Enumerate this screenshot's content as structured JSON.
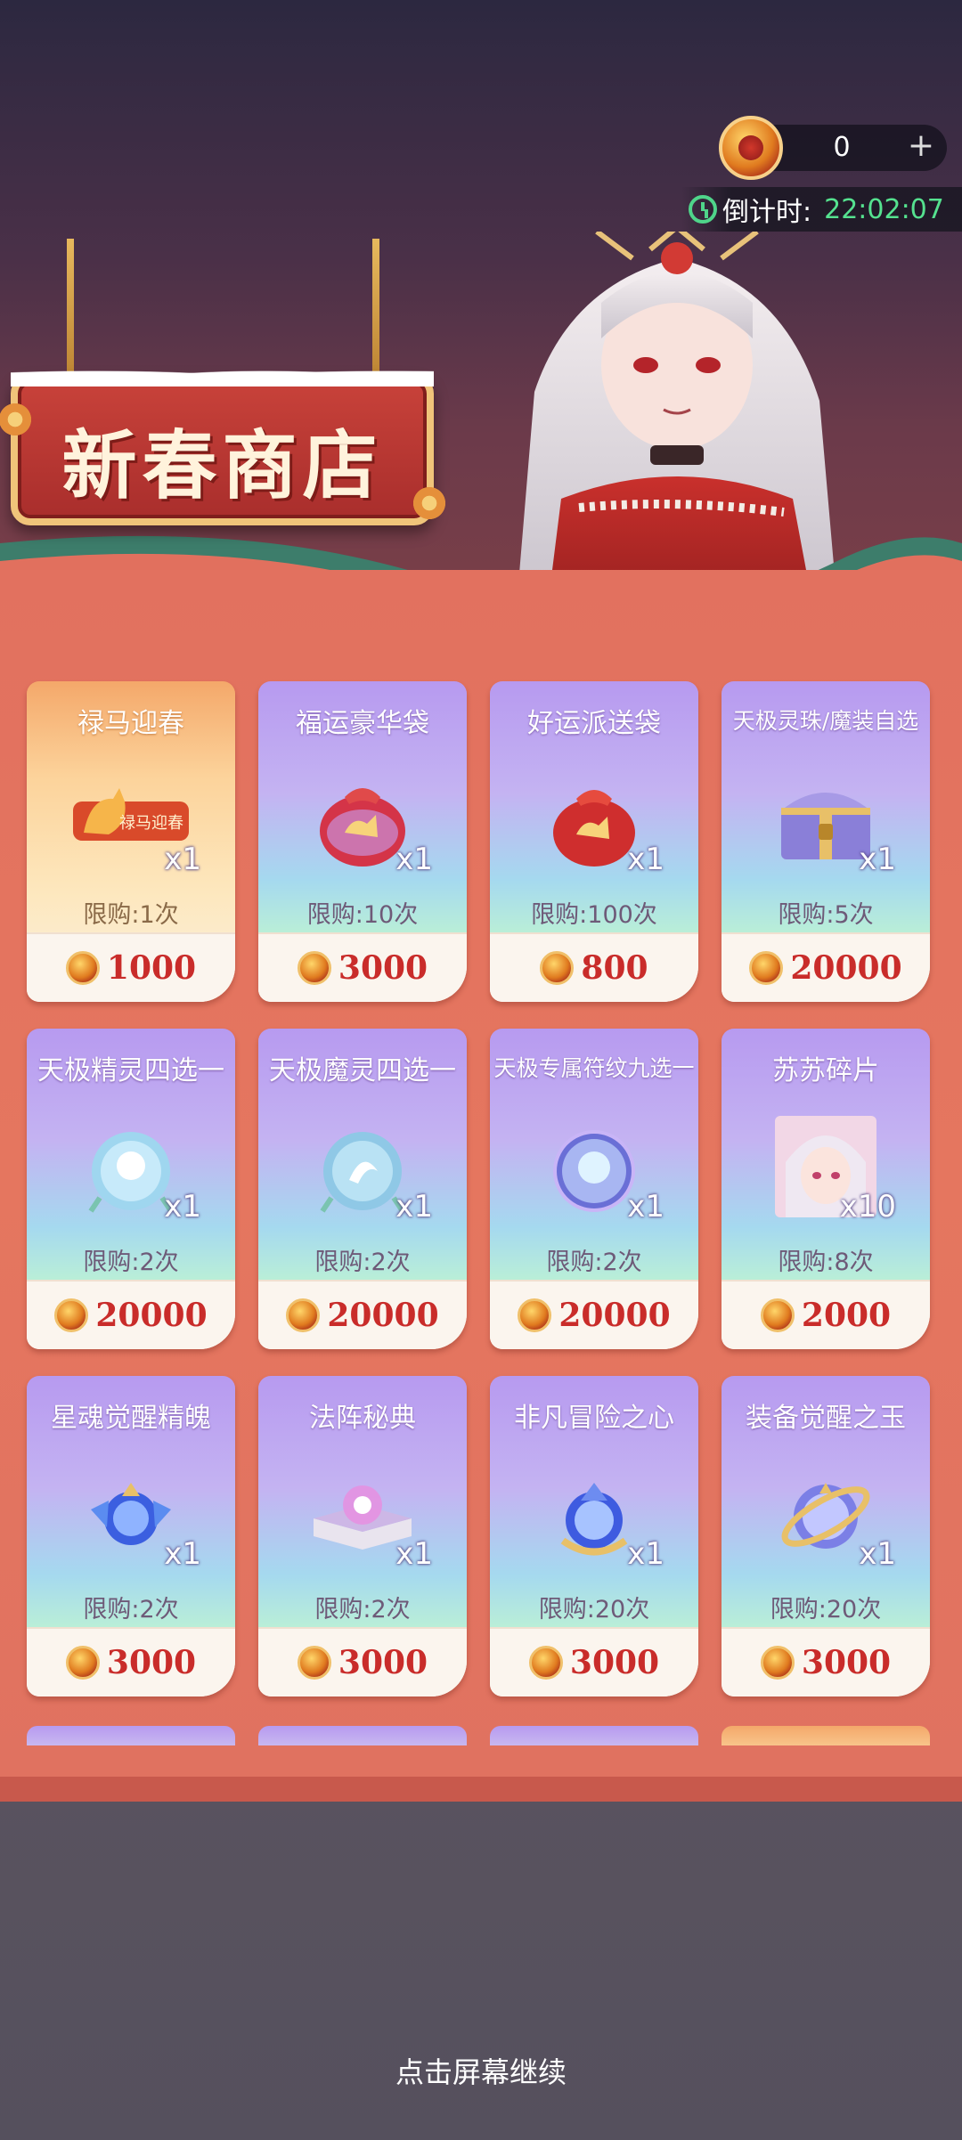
{
  "currency": {
    "value": "0",
    "plus": "+"
  },
  "countdown": {
    "label": "倒计时:",
    "time": "22:02:07"
  },
  "shop": {
    "title": "新春商店",
    "items": [
      {
        "name": "禄马迎春",
        "qty": "x1",
        "limit": "限购:1次",
        "price": "1000",
        "theme": "gold",
        "icon": "horse-banner-icon"
      },
      {
        "name": "福运豪华袋",
        "qty": "x1",
        "limit": "限购:10次",
        "price": "3000",
        "theme": "purple",
        "icon": "lucky-bag-deluxe-icon"
      },
      {
        "name": "好运派送袋",
        "qty": "x1",
        "limit": "限购:100次",
        "price": "800",
        "theme": "purple",
        "icon": "lucky-bag-icon"
      },
      {
        "name": "天极灵珠/魔装自选",
        "qty": "x1",
        "limit": "限购:5次",
        "price": "20000",
        "theme": "purple",
        "icon": "treasure-chest-icon"
      },
      {
        "name": "天极精灵四选一",
        "qty": "x1",
        "limit": "限购:2次",
        "price": "20000",
        "theme": "purple",
        "icon": "spirit-orb-icon"
      },
      {
        "name": "天极魔灵四选一",
        "qty": "x1",
        "limit": "限购:2次",
        "price": "20000",
        "theme": "purple",
        "icon": "demon-orb-icon"
      },
      {
        "name": "天极专属符纹九选一",
        "qty": "x1",
        "limit": "限购:2次",
        "price": "20000",
        "theme": "purple",
        "icon": "rune-orb-icon"
      },
      {
        "name": "苏苏碎片",
        "qty": "x10",
        "limit": "限购:8次",
        "price": "2000",
        "theme": "purple",
        "icon": "character-portrait-icon"
      },
      {
        "name": "星魂觉醒精魄",
        "qty": "x1",
        "limit": "限购:2次",
        "price": "3000",
        "theme": "purple",
        "icon": "blue-crystal-icon"
      },
      {
        "name": "法阵秘典",
        "qty": "x1",
        "limit": "限购:2次",
        "price": "3000",
        "theme": "purple",
        "icon": "spell-book-icon"
      },
      {
        "name": "非凡冒险之心",
        "qty": "x1",
        "limit": "限购:20次",
        "price": "3000",
        "theme": "purple",
        "icon": "adventure-heart-icon"
      },
      {
        "name": "装备觉醒之玉",
        "qty": "x1",
        "limit": "限购:20次",
        "price": "3000",
        "theme": "purple",
        "icon": "awakening-jade-icon"
      }
    ]
  },
  "footer": {
    "continue": "点击屏幕继续"
  }
}
